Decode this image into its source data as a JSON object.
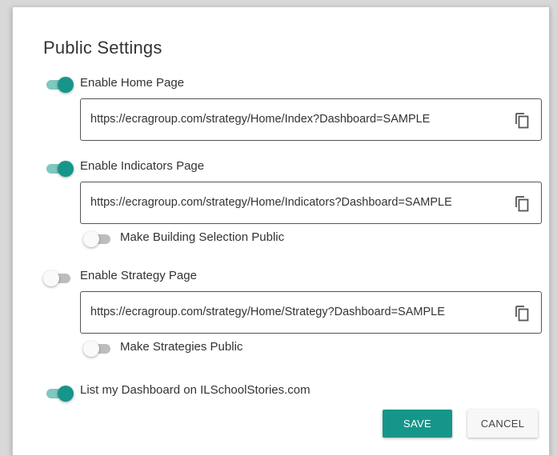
{
  "dialog": {
    "title": "Public Settings",
    "home": {
      "toggle_label": "Enable Home Page",
      "enabled": true,
      "url": "https://ecragroup.com/strategy/Home/Index?Dashboard=SAMPLE"
    },
    "indicators": {
      "toggle_label": "Enable Indicators Page",
      "enabled": true,
      "url": "https://ecragroup.com/strategy/Home/Indicators?Dashboard=SAMPLE",
      "sub_toggle_label": "Make Building Selection Public",
      "sub_enabled": false
    },
    "strategy": {
      "toggle_label": "Enable Strategy Page",
      "enabled": false,
      "url": "https://ecragroup.com/strategy/Home/Strategy?Dashboard=SAMPLE",
      "sub_toggle_label": "Make Strategies Public",
      "sub_enabled": false
    },
    "list": {
      "toggle_label": "List my Dashboard on ILSchoolStories.com",
      "enabled": true
    },
    "buttons": {
      "save": "SAVE",
      "cancel": "CANCEL"
    },
    "colors": {
      "accent": "#16968a",
      "accent_track": "#7fc7bf",
      "off_track": "#bdbdbd"
    },
    "icons": {
      "copy": "copy-icon"
    }
  }
}
